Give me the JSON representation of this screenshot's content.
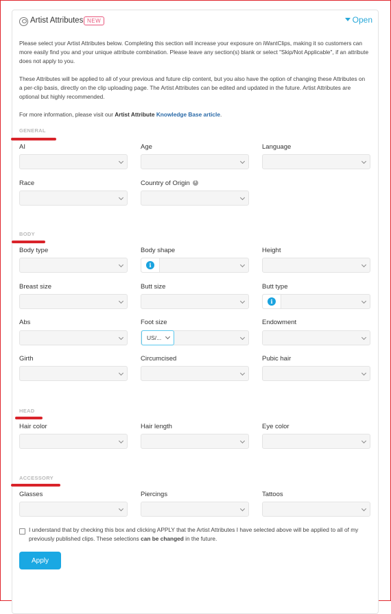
{
  "header": {
    "title": "Artist Attributes",
    "badge": "NEW",
    "toggle_label": "Open"
  },
  "intro": {
    "p1": "Please select your Artist Attributes below. Completing this section will increase your exposure on iWantClips, making it so customers can more easily find you and your unique attribute combination. Please leave any section(s) blank or select \"Skip/Not Applicable\", if an attribute does not apply to you.",
    "p2": "These Attributes will be applied to all of your previous and future clip content, but you also have the option of changing these Attributes on a per-clip basis, directly on the clip uploading page. The Artist Attributes can be edited and updated in the future. Artist Attributes are optional but highly recommended.",
    "p3_prefix": "For more information, please visit our ",
    "p3_bold": "Artist Attribute",
    "p3_link": "Knowledge Base article",
    "p3_suffix": "."
  },
  "sections": {
    "general": "GENERAL",
    "body": "BODY",
    "head": "HEAD",
    "accessory": "ACCESSORY"
  },
  "fields": {
    "ai": "AI",
    "age": "Age",
    "language": "Language",
    "race": "Race",
    "country_of_origin": "Country of Origin",
    "body_type": "Body type",
    "body_shape": "Body shape",
    "height": "Height",
    "breast_size": "Breast size",
    "butt_size": "Butt size",
    "butt_type": "Butt type",
    "abs": "Abs",
    "foot_size": "Foot size",
    "foot_size_unit": "US/...",
    "endowment": "Endowment",
    "girth": "Girth",
    "circumcised": "Circumcised",
    "pubic_hair": "Pubic hair",
    "hair_color": "Hair color",
    "hair_length": "Hair length",
    "eye_color": "Eye color",
    "glasses": "Glasses",
    "piercings": "Piercings",
    "tattoos": "Tattoos"
  },
  "consent": {
    "text_prefix": "I understand that by checking this box and clicking APPLY that the Artist Attributes I have selected above will be applied to all of my previously published clips. These selections ",
    "text_bold": "can be changed",
    "text_suffix": " in the future."
  },
  "apply_label": "Apply",
  "colors": {
    "accent": "#1aa8e3",
    "badge": "#e8577c",
    "annotation_red": "#d9232a",
    "link": "#2a6aa8"
  }
}
